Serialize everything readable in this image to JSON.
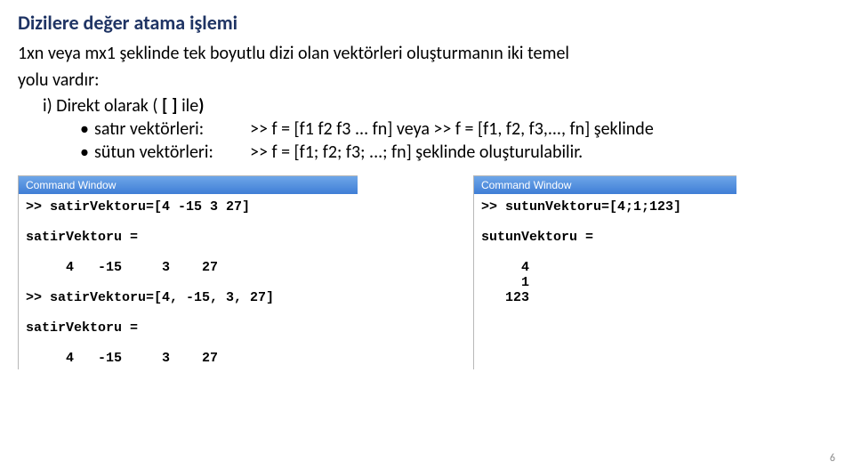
{
  "title": "Dizilere değer atama işlemi",
  "intro_line1": "1xn veya mx1 şeklinde tek boyutlu dizi olan vektörleri oluşturmanın iki temel",
  "intro_line2": "yolu vardır:",
  "sub_prefix": "i) Direkt olarak ( ",
  "sub_bold1": "[",
  "sub_mid": " ",
  "sub_bold2": "]",
  "sub_after_brackets": " ile",
  "sub_bold3": ")",
  "bullet1": {
    "dot": "•",
    "label": "satır vektörleri:",
    "code": ">> f = [f1 f2  f3 ... fn]  veya >> f = [f1, f2, f3,..., fn]  şeklinde"
  },
  "bullet2": {
    "dot": "•",
    "label": "sütun vektörleri:",
    "code": ">> f = [f1; f2; f3; ...; fn] şeklinde oluşturulabilir."
  },
  "cw_title": "Command Window",
  "cw1_body": ">> satirVektoru=[4 -15 3 27]\n\nsatirVektoru =\n\n     4   -15     3    27\n\n>> satirVektoru=[4, -15, 3, 27]\n\nsatirVektoru =\n\n     4   -15     3    27",
  "cw2_body": ">> sutunVektoru=[4;1;123]\n\nsutunVektoru =\n\n     4\n     1\n   123\n",
  "page_number": "6"
}
